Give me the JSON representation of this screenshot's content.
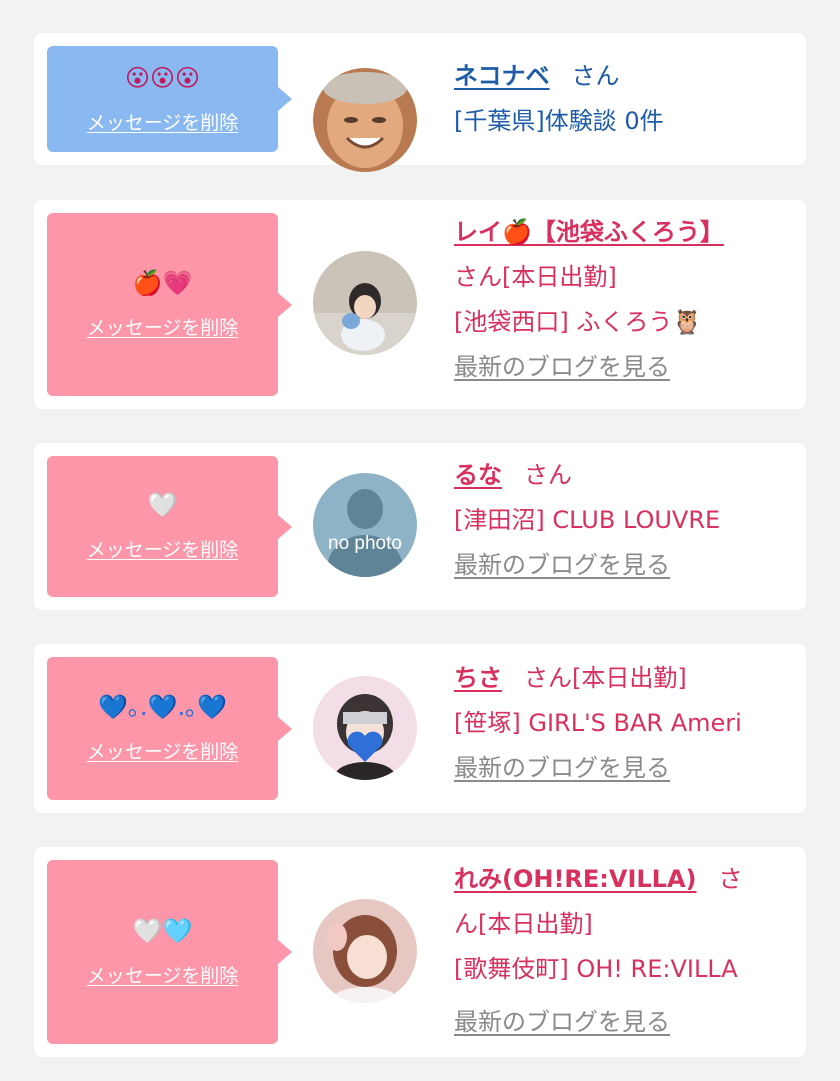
{
  "colors": {
    "page_background": "#f2f2f2",
    "card_background": "#ffffff",
    "bubble_blue": "#8ab8f0",
    "bubble_pink": "#fc96a8",
    "text_blue": "#1e5ca8",
    "text_pink": "#d8305f",
    "link_gray": "#8a8a8a"
  },
  "delete_label": "メッセージを削除",
  "honorific": "さん",
  "blog_link": "最新のブログを見る",
  "cards": [
    {
      "bubble_color": "blue",
      "emoji": "😮😮😮",
      "icons": [
        "surprised-face-icon",
        "surprised-face-icon",
        "surprised-face-icon"
      ],
      "name": "ネコナベ",
      "name_suffix": "",
      "line2": "[千葉県]体験談 0件",
      "line3": ""
    },
    {
      "bubble_color": "pink",
      "emoji": "🍎💗",
      "icons": [
        "red-apple-icon",
        "growing-heart-icon"
      ],
      "name": "レイ🍎【池袋ふくろう】",
      "name_suffix": "さん[本日出勤]",
      "line2": "[池袋西口] ふくろう🦉",
      "line3": ""
    },
    {
      "bubble_color": "pink",
      "emoji": "🤍",
      "icons": [
        "white-heart-icon"
      ],
      "name": "るな",
      "name_suffix": "",
      "line2": "[津田沼] CLUB LOUVRE",
      "line3": "",
      "avatar_text": "no photo"
    },
    {
      "bubble_color": "pink",
      "emoji": "💙｡.💙.｡💙",
      "icons": [
        "blue-heart-icon",
        "blue-heart-icon",
        "blue-heart-icon"
      ],
      "name": "ちさ",
      "name_suffix": "さん[本日出勤]",
      "line2": "[笹塚] GIRL'S BAR Ameri",
      "line3": ""
    },
    {
      "bubble_color": "pink",
      "emoji": "🤍🩵",
      "icons": [
        "white-heart-icon",
        "light-blue-heart-icon"
      ],
      "name": "れみ(OH!RE:VILLA)",
      "name_suffix": "さ",
      "line_wrap": "ん[本日出勤]",
      "line2": "[歌舞伎町] OH! RE:VILLA",
      "line3": ""
    }
  ]
}
